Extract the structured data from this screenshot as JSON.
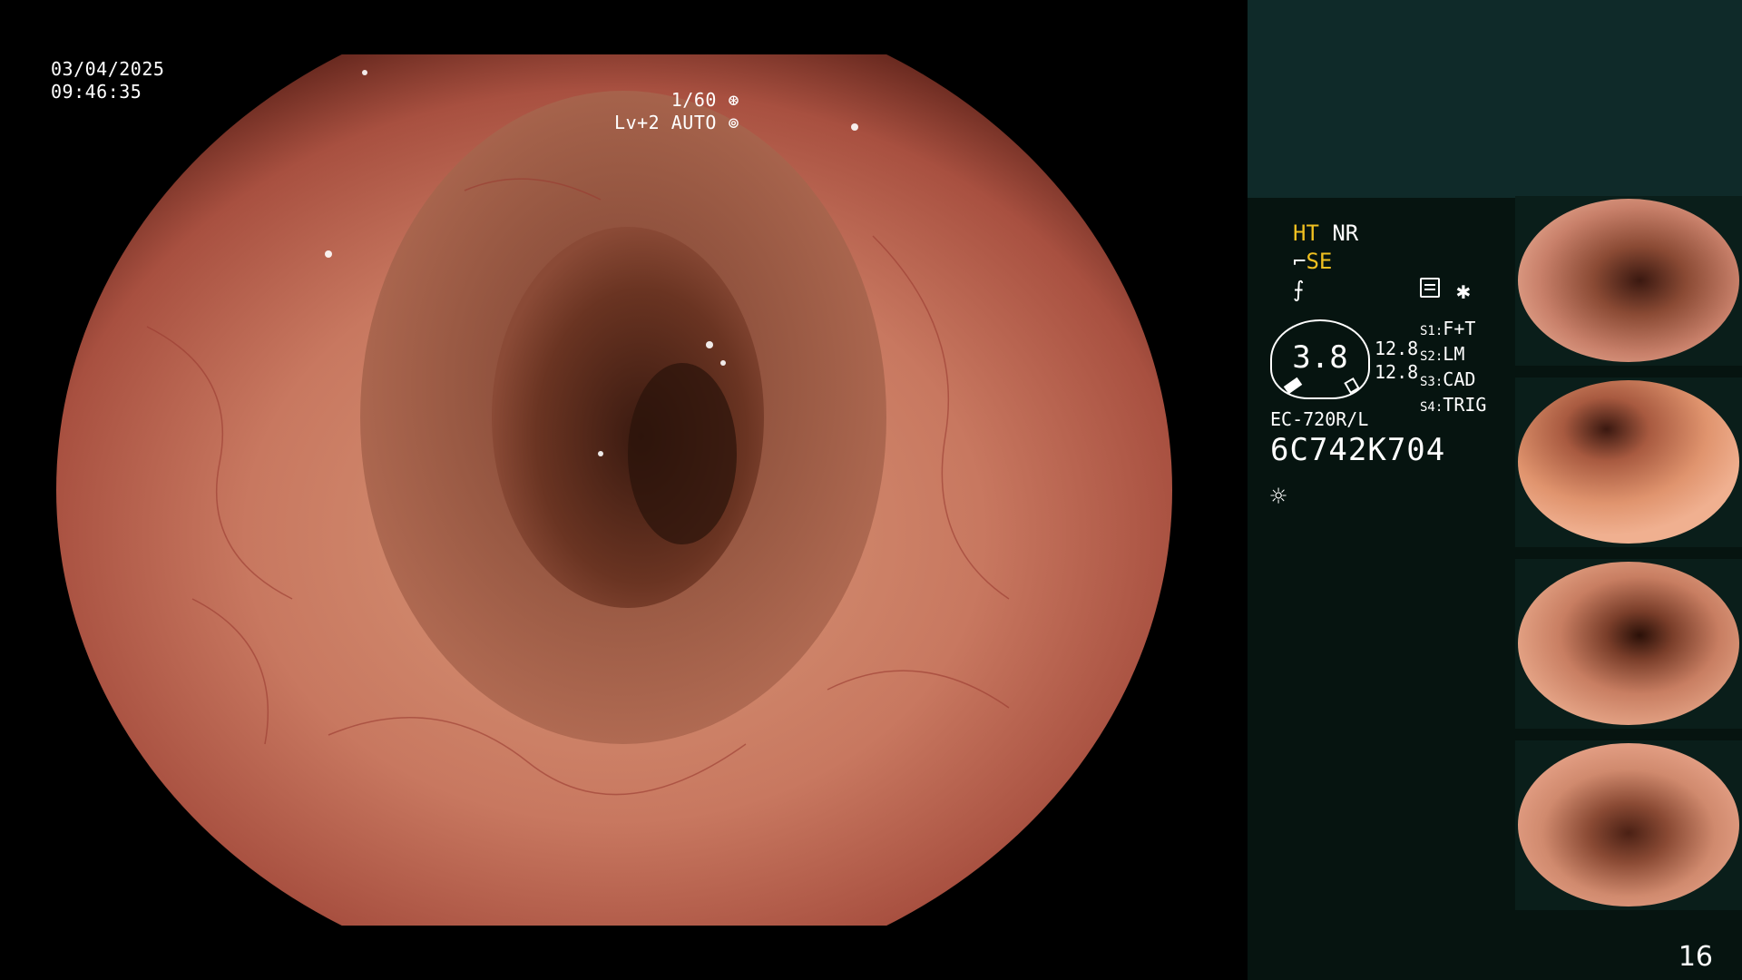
{
  "main": {
    "date": "03/04/2025",
    "time": "09:46:35",
    "shutter": "1/60",
    "level": "Lv+2 AUTO"
  },
  "panel": {
    "ht": "HT",
    "nr": "NR",
    "se": "SE",
    "f_symbol": "⨍",
    "star": "✱",
    "gauge_value": "3.8",
    "gauge_num1": "12.8",
    "gauge_num2": "12.8",
    "scope_settings": [
      {
        "key": "S1:",
        "value": "F+T"
      },
      {
        "key": "S2:",
        "value": "LM"
      },
      {
        "key": "S3:",
        "value": "CAD"
      },
      {
        "key": "S4:",
        "value": "TRIG"
      }
    ],
    "model": "EC-720R/L",
    "serial": "6C742K704",
    "light_symbol": "☼"
  },
  "page_number": "16",
  "colors": {
    "panel_bg": "#061410",
    "panel_top": "#0f2a29",
    "accent": "#f0c020"
  }
}
